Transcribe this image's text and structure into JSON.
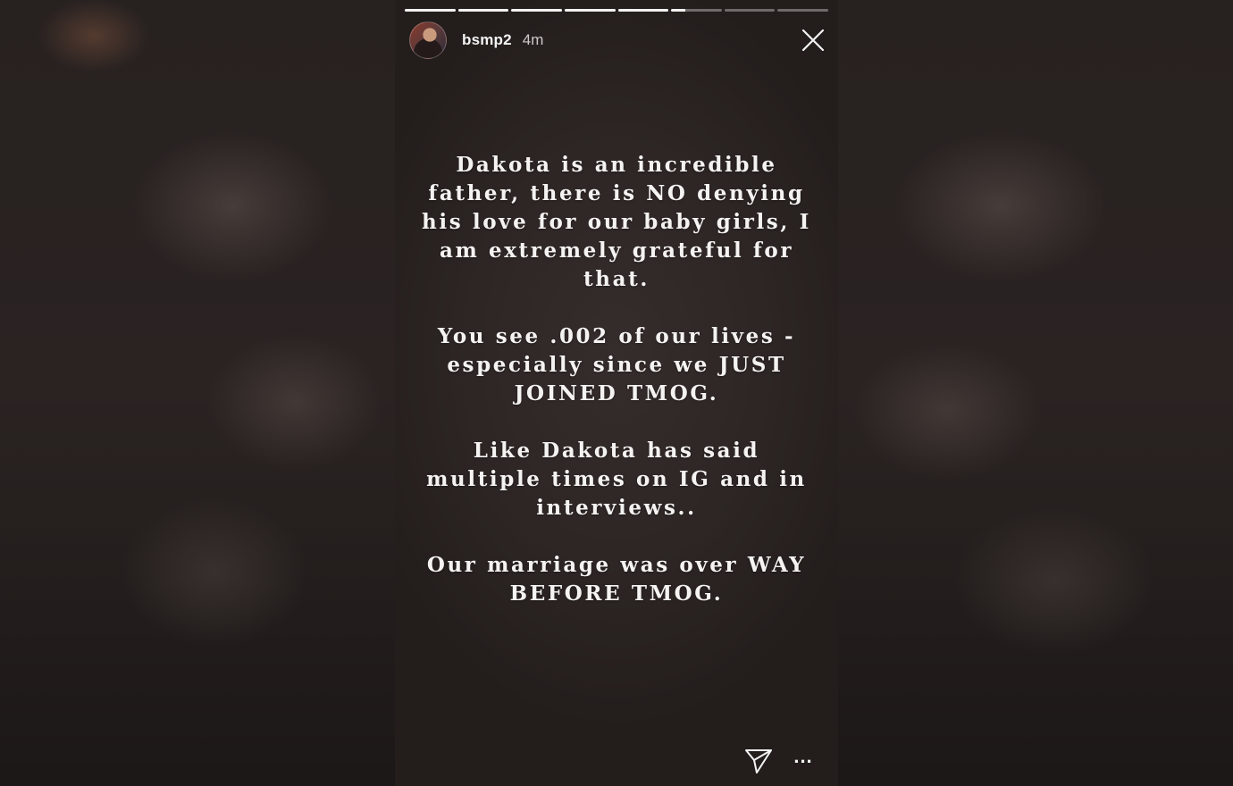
{
  "story": {
    "username": "bsmp2",
    "time": "4m",
    "progress_segments": [
      1,
      1,
      1,
      1,
      1,
      0.28,
      0,
      0
    ],
    "paragraphs": [
      "Dakota is an incredible father, there is NO denying his love for our baby girls, I am extremely grateful for that.",
      "You see .002 of our lives - especially since we JUST JOINED TMOG.",
      "Like Dakota has said multiple times on IG and in interviews..",
      "Our marriage was over WAY BEFORE TMOG."
    ],
    "more_label": "...",
    "icons": {
      "close": "close-icon",
      "send": "send-icon",
      "more": "more-icon"
    },
    "colors": {
      "story_background": "#2d2624",
      "text": "#f5f3f2",
      "progress_active": "#f2f2f2",
      "progress_inactive": "rgba(255,255,255,0.35)"
    }
  }
}
